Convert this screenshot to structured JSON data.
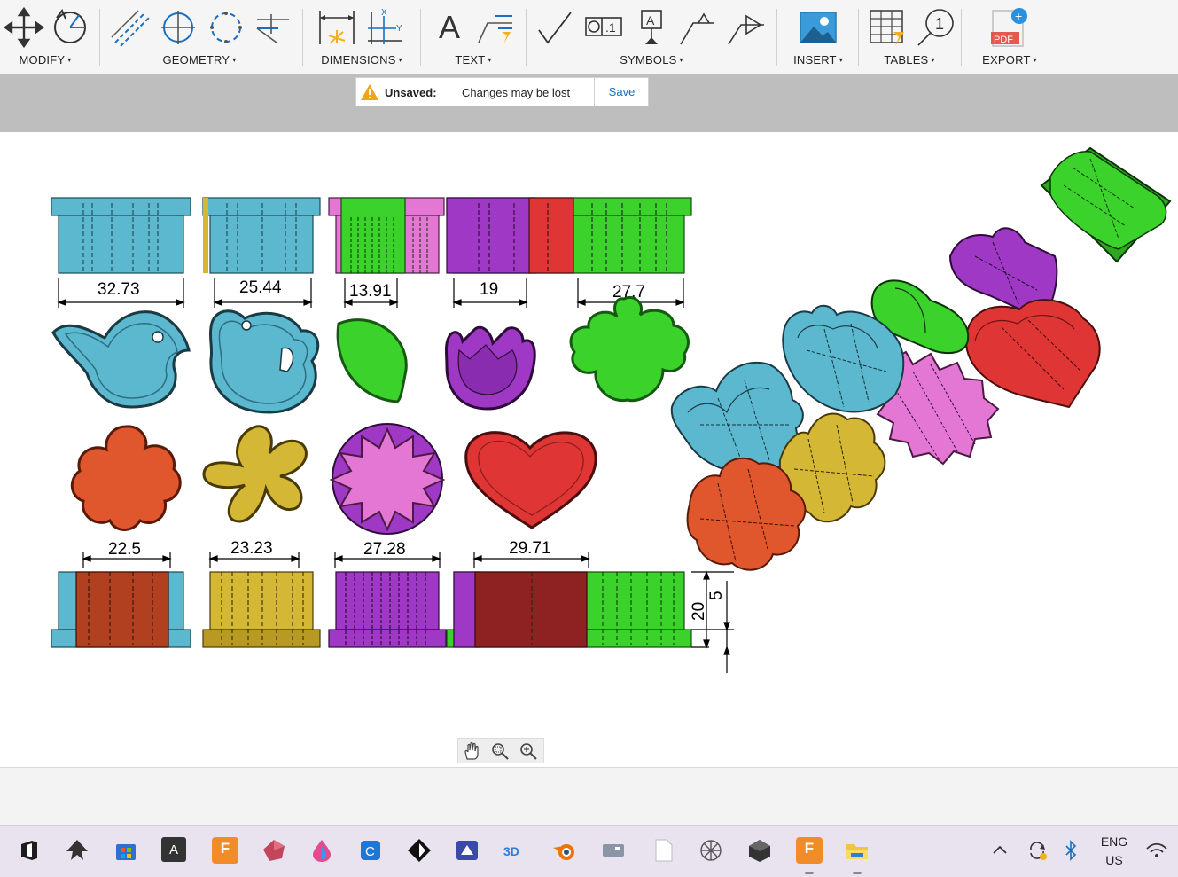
{
  "toolbar": {
    "groups": {
      "modify": "MODIFY",
      "geometry": "GEOMETRY",
      "dimensions": "DIMENSIONS",
      "text": "TEXT",
      "symbols": "SYMBOLS",
      "insert": "INSERT",
      "tables": "TABLES",
      "export": "EXPORT"
    },
    "caret": "▾",
    "text_glyph": "A",
    "pdf_glyph": "PDF",
    "balloon_glyph": "1"
  },
  "banner": {
    "label": "Unsaved:",
    "message": "Changes may be lost",
    "save": "Save"
  },
  "dimensions": {
    "top": [
      "32.73",
      "25.44",
      "13.91",
      "19",
      "27.7"
    ],
    "bottom": [
      "22.5",
      "23.23",
      "27.28",
      "29.71"
    ],
    "height_total": "20",
    "height_base": "5"
  },
  "colors": {
    "blue": "#5bb8cf",
    "yellow": "#d4b734",
    "pink": "#e377d3",
    "purple": "#9f38c4",
    "red": "#e03535",
    "green": "#3cd22c",
    "orange": "#e0572e",
    "accent": "#1a6fc1"
  },
  "taskbar": {
    "lang_top": "ENG",
    "lang_bottom": "US",
    "app_glyph": "A",
    "fusion_glyph": "F"
  }
}
